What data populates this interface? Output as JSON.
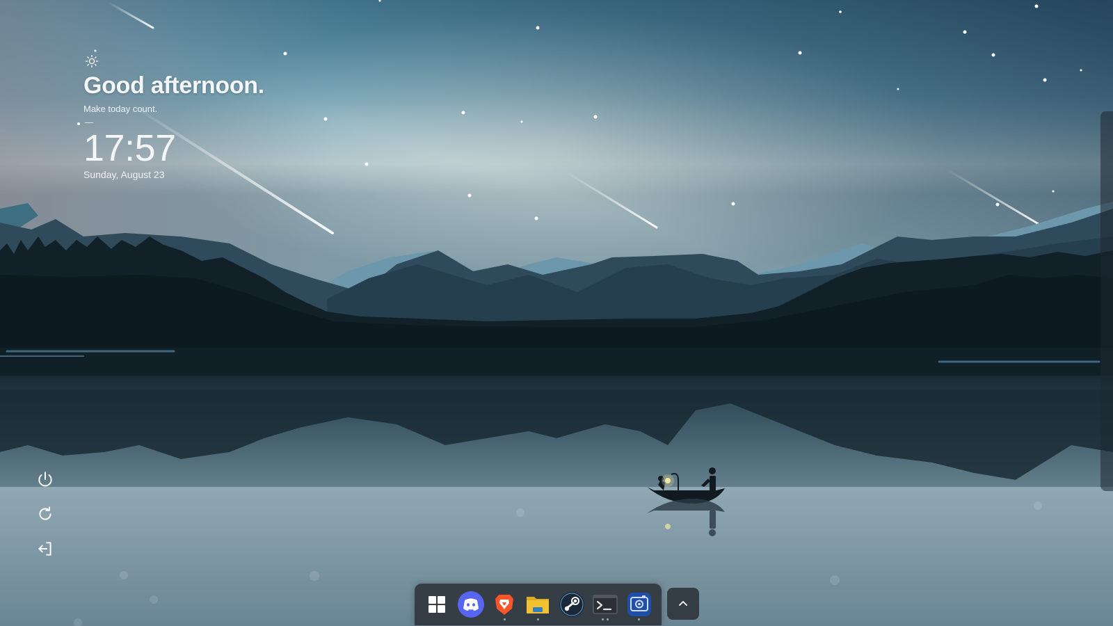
{
  "greeting": {
    "weather_icon": "sun-icon",
    "title": "Good afternoon.",
    "subtitle": "Make today count.",
    "time": "17:57",
    "date": "Sunday, August 23"
  },
  "power_controls": [
    {
      "name": "power-button",
      "icon": "power-icon"
    },
    {
      "name": "restart-button",
      "icon": "restart-icon"
    },
    {
      "name": "logout-button",
      "icon": "logout-icon"
    }
  ],
  "taskbar": {
    "items": [
      {
        "name": "start-button",
        "icon": "windows-start-icon",
        "indicator": "none"
      },
      {
        "name": "discord-app",
        "icon": "discord-icon",
        "indicator": "none"
      },
      {
        "name": "brave-app",
        "icon": "brave-browser-icon",
        "indicator": "dot"
      },
      {
        "name": "file-explorer-app",
        "icon": "folder-icon",
        "indicator": "dot"
      },
      {
        "name": "steam-app",
        "icon": "steam-icon",
        "indicator": "none"
      },
      {
        "name": "terminal-app",
        "icon": "terminal-icon",
        "indicator": "double-dot"
      },
      {
        "name": "screenshot-app",
        "icon": "camera-settings-icon",
        "indicator": "dot"
      }
    ],
    "tray_toggle_icon": "chevron-up-icon"
  },
  "colors": {
    "sky_top": "#4f8ea8",
    "sky_horizon": "#9fb9c2",
    "mountain_far": "#6d97ab",
    "mountain_mid": "#2e4a5b",
    "forest": "#0f1d24",
    "water": "#8fa8b4",
    "taskbar": "#282c32",
    "discord": "#5865f2",
    "brave": "#fb542b",
    "folder": "#f2c230",
    "steam": "#1b2838"
  }
}
